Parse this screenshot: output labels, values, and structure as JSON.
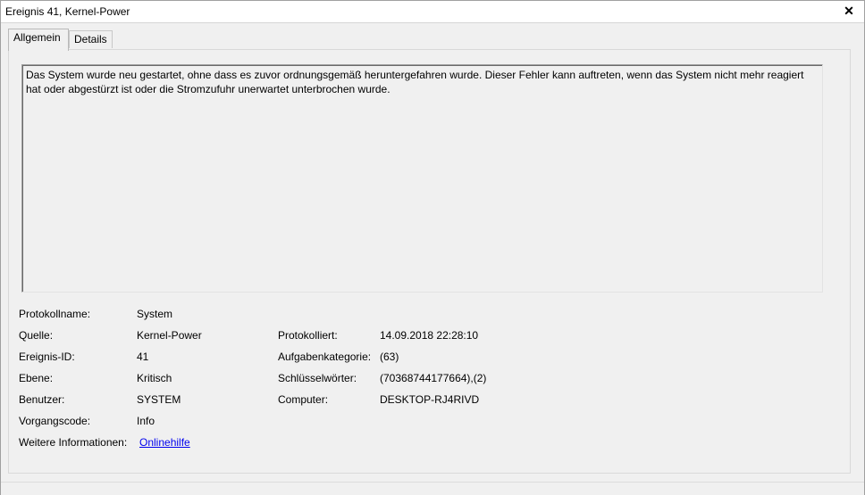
{
  "window": {
    "title": "Ereignis 41, Kernel-Power",
    "close_label": "✕"
  },
  "tabs": [
    {
      "label": "Allgemein",
      "active": true
    },
    {
      "label": "Details",
      "active": false
    }
  ],
  "description": "Das System wurde neu gestartet, ohne dass es zuvor ordnungsgemäß heruntergefahren wurde. Dieser Fehler kann auftreten, wenn das System nicht mehr reagiert hat oder abgestürzt ist oder die Stromzufuhr unerwartet unterbrochen wurde.",
  "fields": {
    "protokollname": {
      "label": "Protokollname:",
      "value": "System"
    },
    "quelle": {
      "label": "Quelle:",
      "value": "Kernel-Power"
    },
    "ereignis_id": {
      "label": "Ereignis-ID:",
      "value": "41"
    },
    "ebene": {
      "label": "Ebene:",
      "value": "Kritisch"
    },
    "benutzer": {
      "label": "Benutzer:",
      "value": "SYSTEM"
    },
    "vorgangscode": {
      "label": "Vorgangscode:",
      "value": "Info"
    },
    "weitere_info": {
      "label": "Weitere Informationen:",
      "value": "Onlinehilfe"
    },
    "protokolliert": {
      "label": "Protokolliert:",
      "value": "14.09.2018 22:28:10"
    },
    "aufgabenkategorie": {
      "label": "Aufgabenkategorie:",
      "value": "(63)"
    },
    "schluesselwoerter": {
      "label": "Schlüsselwörter:",
      "value": "(70368744177664),(2)"
    },
    "computer": {
      "label": "Computer:",
      "value": "DESKTOP-RJ4RIVD"
    }
  }
}
